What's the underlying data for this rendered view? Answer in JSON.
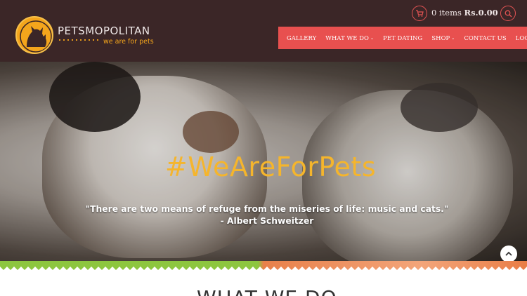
{
  "brand": {
    "name": "PETSMOPOLITAN",
    "tagline": "we are for pets"
  },
  "cart": {
    "items_text": "0 items",
    "amount": "Rs.0.00"
  },
  "nav": {
    "items": [
      {
        "label": "GALLERY"
      },
      {
        "label": "WHAT WE DO"
      },
      {
        "label": "PET DATING"
      },
      {
        "label": "SHOP"
      },
      {
        "label": "CONTACT US"
      },
      {
        "label": "LOG IN"
      }
    ]
  },
  "hero": {
    "hashtag": "#WeAreForPets",
    "quote": "\"There are two means of refuge from the miseries of life: music and cats.\"",
    "author": "- Albert Schweitzer"
  },
  "section": {
    "title": "WHAT WE DO"
  },
  "colors": {
    "header_bg": "#3b2627",
    "accent_red": "#e8504f",
    "accent_orange": "#f4a51c"
  },
  "icons": {
    "cart": "cart-icon",
    "search": "search-icon",
    "scroll_top": "chevron-up-icon",
    "dropdown": "chevron-down-icon"
  }
}
